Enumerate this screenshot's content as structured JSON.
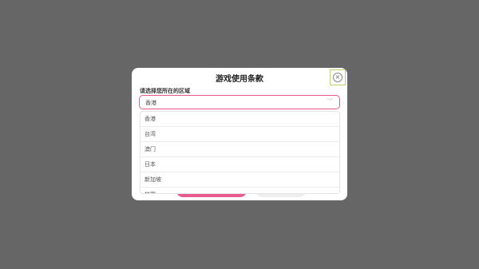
{
  "dialog": {
    "title": "游戏使用条款",
    "close_icon": "close-circle-icon",
    "region_label": "请选择您所在的区域",
    "select": {
      "value": "香港",
      "chevron_icon": "chevron-down-icon"
    },
    "options": [
      "香港",
      "台湾",
      "澳门",
      "日本",
      "新加坡",
      "韩国"
    ]
  },
  "colors": {
    "overlay": "#666666",
    "accent": "#ea5b8d",
    "close_highlight": "#b8d36a"
  }
}
